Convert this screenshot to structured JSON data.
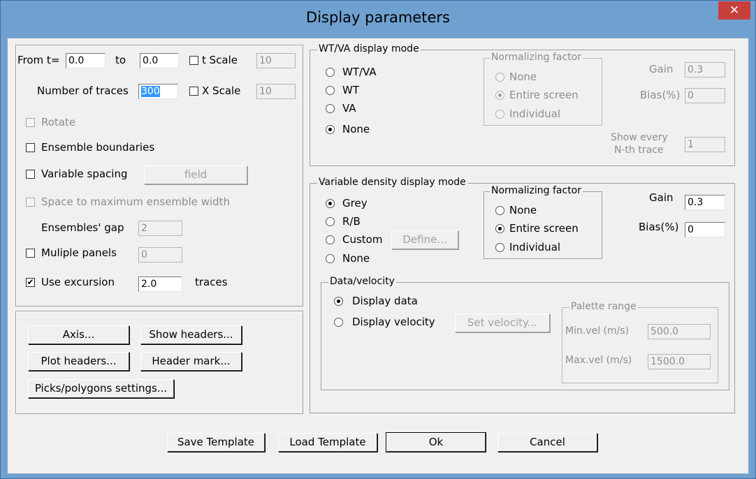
{
  "window": {
    "title": "Display parameters",
    "close_symbol": "✕"
  },
  "left_top": {
    "from_label": "From t=",
    "from_value": "0.0",
    "to_label": "to",
    "to_value": "0.0",
    "t_scale_label": "t Scale",
    "t_scale_value": "10",
    "num_traces_label": "Number of traces",
    "num_traces_value": "300",
    "x_scale_label": "X Scale",
    "x_scale_value": "10",
    "rotate_label": "Rotate",
    "ensemble_boundaries_label": "Ensemble boundaries",
    "variable_spacing_label": "Variable spacing",
    "field_button": "field",
    "space_max_label": "Space to maximum ensemble width",
    "ensembles_gap_label": "Ensembles' gap",
    "ensembles_gap_value": "2",
    "multiple_panels_label": "Muliple panels",
    "multiple_panels_value": "0",
    "use_excursion_label": "Use excursion",
    "use_excursion_checked": "✔",
    "excursion_value": "2.0",
    "traces_label": "traces"
  },
  "left_bottom": {
    "axis_button": "Axis...",
    "show_headers_button": "Show headers...",
    "plot_headers_button": "Plot headers...",
    "header_mark_button": "Header mark...",
    "picks_button": "Picks/polygons settings..."
  },
  "wtva": {
    "title": "WT/VA display mode",
    "options": [
      "WT/VA",
      "WT",
      "VA",
      "None"
    ],
    "selected": "None",
    "norm_title": "Normalizing factor",
    "norm_options": [
      "None",
      "Entire screen",
      "Individual"
    ],
    "gain_label": "Gain",
    "gain_value": "0.3",
    "bias_label": "Bias(%)",
    "bias_value": "0",
    "show_every_label1": "Show every",
    "show_every_label2": "N-th trace",
    "show_every_value": "1"
  },
  "vd": {
    "title": "Variable density display mode",
    "options": [
      "Grey",
      "R/B",
      "Custom",
      "None"
    ],
    "define_button": "Define...",
    "norm_title": "Normalizing factor",
    "norm_options": [
      "None",
      "Entire screen",
      "Individual"
    ],
    "gain_label": "Gain",
    "gain_value": "0.3",
    "bias_label": "Bias(%)",
    "bias_value": "0",
    "dv_title": "Data/velocity",
    "display_data_label": "Display data",
    "display_velocity_label": "Display velocity",
    "set_velocity_button": "Set velocity...",
    "palette_title": "Palette range",
    "min_vel_label": "Min.vel (m/s)",
    "min_vel_value": "500.0",
    "max_vel_label": "Max.vel (m/s)",
    "max_vel_value": "1500.0"
  },
  "footer": {
    "save_template": "Save Template",
    "load_template": "Load Template",
    "ok": "Ok",
    "cancel": "Cancel"
  }
}
